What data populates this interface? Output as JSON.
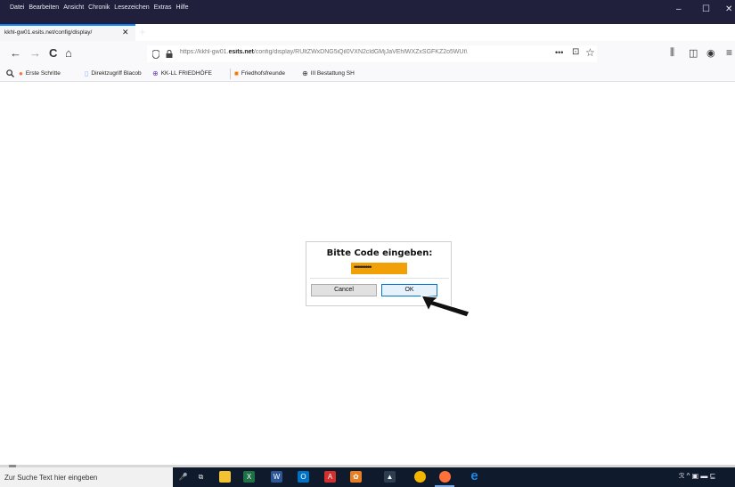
{
  "menu": [
    "Datei",
    "Bearbeiten",
    "Ansicht",
    "Chronik",
    "Lesezeichen",
    "Extras",
    "Hilfe"
  ],
  "window_controls": {
    "minimize": "–",
    "maximize": "☐",
    "close": "✕"
  },
  "tab": {
    "title": "kkhl-gw01.esits.net/config/display/",
    "close": "✕",
    "new_tab": "+"
  },
  "nav": {
    "back": "←",
    "forward": "→",
    "reload": "C",
    "home": "⌂"
  },
  "url": {
    "prefix": "https://kkhl-gw01.",
    "domain": "esits.net",
    "path": "/config/display/RUltZWxDNG5iQil0VXN2cldGMjJaVEhlWXZxSGFKZ2o5WUt\\",
    "more": "•••",
    "pocket": "⊡",
    "star": "☆"
  },
  "toolbar_right": {
    "library": "⫼",
    "sidebar": "◫",
    "account": "◉",
    "menu": "≡"
  },
  "bookmarks": [
    {
      "icon": "search-icon",
      "glyph": "🔍",
      "label": ""
    },
    {
      "icon": "firefox-icon",
      "glyph": "●",
      "label": "Erste Schritte"
    },
    {
      "icon": "page-icon",
      "glyph": "▯",
      "label": "Direktzugriff Blacob"
    },
    {
      "icon": "link-icon",
      "glyph": "⊕",
      "label": "KK-LL FRIEDHÖFE"
    },
    {
      "icon": "orange-square-icon",
      "glyph": "■",
      "label": "Friedhofsfreunde"
    },
    {
      "icon": "globe-icon",
      "glyph": "⊕",
      "label": "III Bestattung SH"
    }
  ],
  "dialog": {
    "title": "Bitte Code eingeben:",
    "password_mask": "•••••••••",
    "cancel_label": "Cancel",
    "ok_label": "OK"
  },
  "taskbar": {
    "search_placeholder": "Zur Suche Text hier eingeben",
    "apps": [
      {
        "name": "mic-icon",
        "glyph": "🎤",
        "color": "transparent"
      },
      {
        "name": "task-view-icon",
        "glyph": "⧉",
        "color": "transparent"
      },
      {
        "name": "file-explorer-icon",
        "glyph": "▬",
        "color": "#f2c230"
      },
      {
        "name": "excel-icon",
        "glyph": "X",
        "color": "#1e7145"
      },
      {
        "name": "word-icon",
        "glyph": "W",
        "color": "#2b5797"
      },
      {
        "name": "outlook-icon",
        "glyph": "O",
        "color": "#0072c6"
      },
      {
        "name": "acrobat-icon",
        "glyph": "A",
        "color": "#d32f2f"
      },
      {
        "name": "app-orange-icon",
        "glyph": "✿",
        "color": "#e67e22"
      },
      {
        "name": "photos-icon",
        "glyph": "▲",
        "color": "#2d3e50"
      },
      {
        "name": "chrome-icon",
        "glyph": "◎",
        "color": "#f4b400"
      },
      {
        "name": "firefox-icon",
        "glyph": "●",
        "color": "#ff7139"
      },
      {
        "name": "edge-icon",
        "glyph": "e",
        "color": "#1e88e5"
      }
    ],
    "tray": "ℛ  ^  ▣  ▬  ⊑"
  }
}
